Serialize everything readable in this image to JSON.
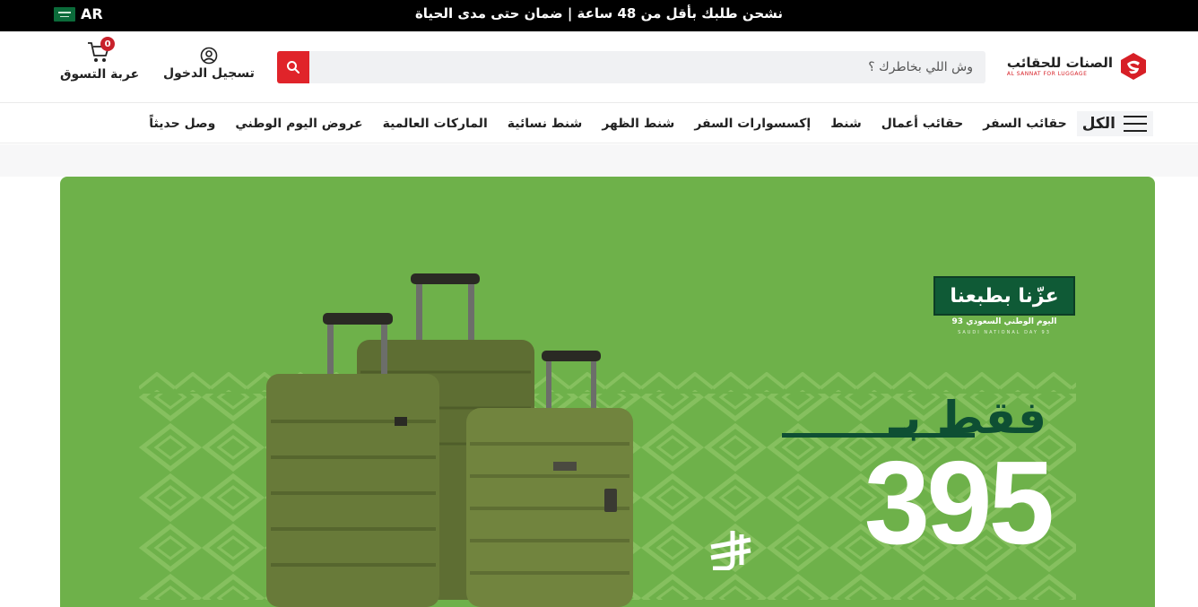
{
  "topbar": {
    "announcement": "نشحن طلبك بأقل من 48 ساعة | ضمان حتى مدى الحياة",
    "language": "AR"
  },
  "header": {
    "logo_ar": "الصنات للحقائب",
    "logo_en": "AL SANNAT FOR LUGGAGE",
    "search_placeholder": "وش اللي بخاطرك ؟",
    "login_label": "تسجيل الدخول",
    "cart_label": "عربة التسوق",
    "cart_count": "0"
  },
  "nav": {
    "all_label": "الكل",
    "items": [
      "حقائب السفر",
      "حقائب أعمال",
      "شنط",
      "إكسسوارات السفر",
      "شنط الظهر",
      "شنط نسائية",
      "الماركات العالمية",
      "عروض اليوم الوطني",
      "وصل حديثاً"
    ]
  },
  "hero": {
    "badge_title": "عزّنا بطبعنا",
    "badge_sub": "اليوم الوطني السعودي 93",
    "badge_sub_en": "SAUDI NATIONAL DAY 93",
    "only_text": "فقط بـ",
    "price": "395",
    "colors": {
      "background": "#6eb14a",
      "pattern": "#86c05f",
      "dark_green": "#0e4f33"
    }
  },
  "colors": {
    "accent": "#e0242a",
    "topbar": "#000000"
  }
}
